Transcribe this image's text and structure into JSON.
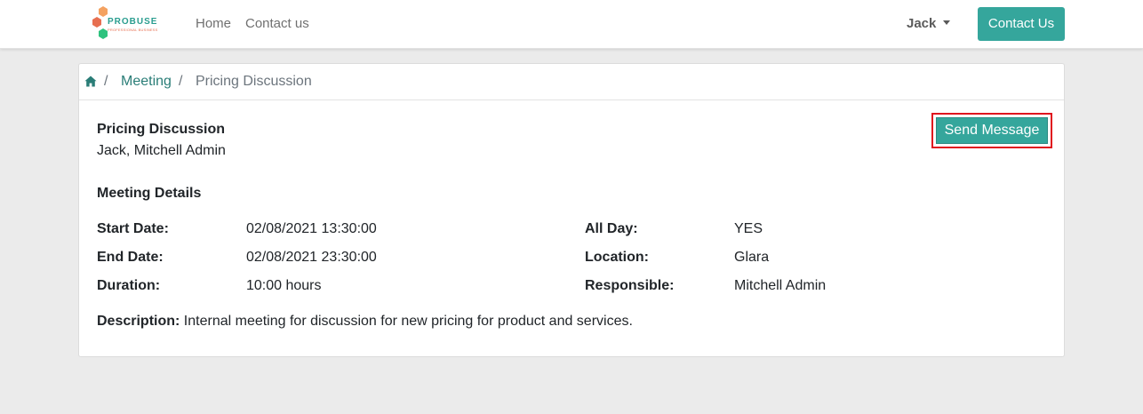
{
  "navbar": {
    "logo": {
      "text": "PROBUSE",
      "subtext": "PROFESSIONAL BUSINESS"
    },
    "links": [
      {
        "label": "Home"
      },
      {
        "label": "Contact us"
      }
    ],
    "user": "Jack",
    "cta_label": "Contact Us",
    "accent_color": "#35a69c"
  },
  "breadcrumb": {
    "separator": "/",
    "items": [
      "Meeting",
      "Pricing Discussion"
    ]
  },
  "meeting": {
    "title": "Pricing Discussion",
    "attendees": "Jack, Mitchell Admin",
    "send_message_label": "Send Message",
    "section_title": "Meeting Details",
    "details_left": [
      {
        "label": "Start Date:",
        "value": "02/08/2021 13:30:00"
      },
      {
        "label": "End Date:",
        "value": "02/08/2021 23:30:00"
      },
      {
        "label": "Duration:",
        "value": "10:00 hours"
      }
    ],
    "details_right": [
      {
        "label": "All Day:",
        "value": "YES"
      },
      {
        "label": "Location:",
        "value": "Glara"
      },
      {
        "label": "Responsible:",
        "value": "Mitchell Admin"
      }
    ],
    "description_label": "Description:",
    "description": "Internal meeting for discussion for new pricing for product and services."
  }
}
